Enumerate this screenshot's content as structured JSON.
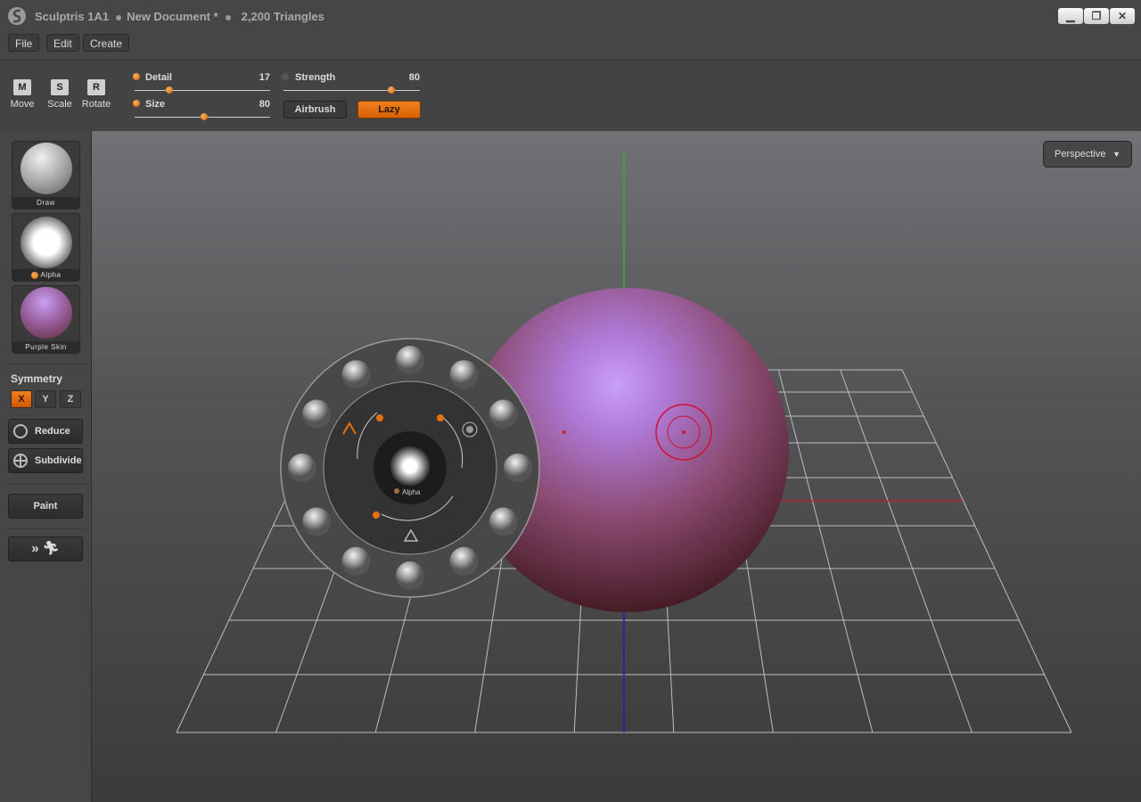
{
  "titlebar": {
    "app": "Sculptris 1A1",
    "document": "New Document *",
    "triangles": "2,200 Triangles",
    "menus": [
      "File",
      "Edit",
      "Create"
    ],
    "window_buttons": [
      "minimize",
      "restore",
      "close"
    ]
  },
  "toolbar": {
    "tools": [
      {
        "key": "M",
        "label": "Move"
      },
      {
        "key": "S",
        "label": "Scale"
      },
      {
        "key": "R",
        "label": "Rotate"
      }
    ],
    "sliders": [
      {
        "label": "Detail",
        "value": "17",
        "fraction": 0.24
      },
      {
        "label": "Size",
        "value": "80",
        "fraction": 0.51
      },
      {
        "label": "Strength",
        "value": "80",
        "fraction": 0.8
      }
    ],
    "airbrush": "Airbrush",
    "lazy": "Lazy",
    "lazy_active": true
  },
  "sidebar": {
    "brush": "Draw",
    "alpha": "Alpha",
    "material": "Purple Skin",
    "symmetry_label": "Symmetry",
    "symmetry": [
      {
        "axis": "X",
        "active": true
      },
      {
        "axis": "Y",
        "active": false
      },
      {
        "axis": "Z",
        "active": false
      }
    ],
    "reduce": "Reduce",
    "subdivide": "Subdivide",
    "paint": "Paint",
    "posing_icon": "running-figure-icon"
  },
  "viewport": {
    "projection": "Perspective",
    "radial_alpha": "Alpha"
  },
  "colors": {
    "accent": "#e8700a",
    "material": "#b070d0",
    "axis_x": "#c02020",
    "axis_y": "#30b030",
    "axis_z": "#2020b0"
  }
}
